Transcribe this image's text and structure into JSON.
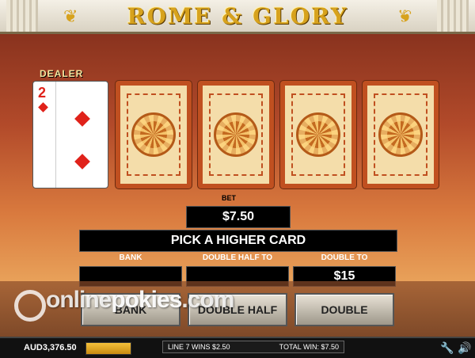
{
  "header": {
    "title": "ROME & GLORY"
  },
  "table": {
    "dealer_label": "DEALER",
    "dealer_card": {
      "rank": "2",
      "suit": "diamonds"
    },
    "face_down_cards": 4,
    "bet_label": "BET",
    "bet_value": "$7.50",
    "message": "PICK A HIGHER CARD",
    "columns": [
      {
        "label": "BANK",
        "value": ""
      },
      {
        "label": "DOUBLE HALF TO",
        "value": ""
      },
      {
        "label": "DOUBLE TO",
        "value": "$15"
      }
    ],
    "buttons": {
      "bank": "BANK",
      "double_half": "DOUBLE HALF",
      "double": "DOUBLE"
    }
  },
  "watermark": {
    "part1": "online",
    "part2": "pokies",
    "part3": ".com"
  },
  "status_bar": {
    "balance": "AUD3,376.50",
    "line_wins": "LINE 7 WINS $2.50",
    "total_win": "TOTAL WIN: $7.50",
    "icons": [
      "wrench-icon",
      "speaker-icon"
    ]
  }
}
